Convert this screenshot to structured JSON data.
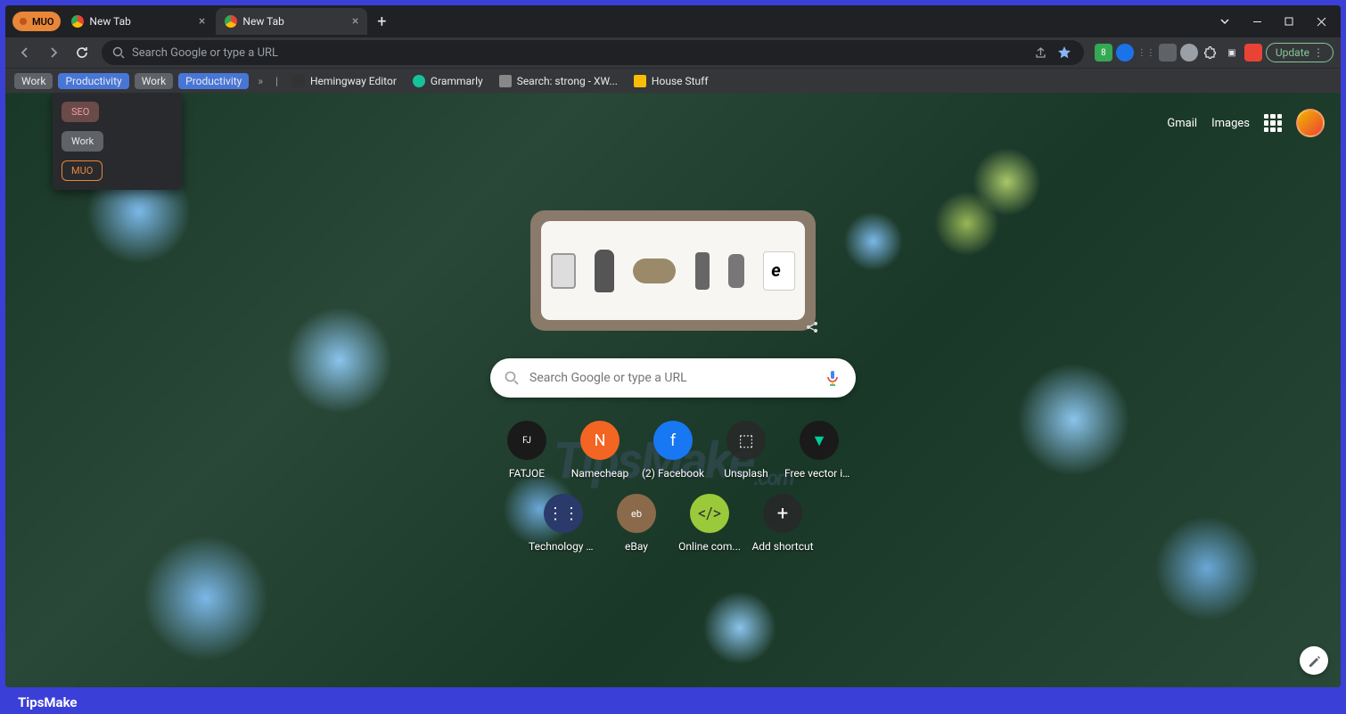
{
  "window": {
    "tabs": [
      {
        "label": "MUO",
        "type": "group"
      },
      {
        "label": "New Tab",
        "type": "tab"
      },
      {
        "label": "New Tab",
        "type": "tab",
        "active": true
      }
    ],
    "update_label": "Update"
  },
  "omnibox": {
    "placeholder": "Search Google or type a URL"
  },
  "bookmarks": {
    "groups": [
      "Work",
      "Productivity",
      "Work",
      "Productivity"
    ],
    "items": [
      {
        "label": "Hemingway Editor"
      },
      {
        "label": "Grammarly"
      },
      {
        "label": "Search: strong - XW..."
      },
      {
        "label": "House Stuff"
      }
    ]
  },
  "group_dropdown": {
    "items": [
      "SEO",
      "Work",
      "MUO"
    ]
  },
  "top_links": {
    "gmail": "Gmail",
    "images": "Images"
  },
  "search": {
    "placeholder": "Search Google or type a URL"
  },
  "shortcuts": {
    "row1": [
      {
        "label": "FATJOE"
      },
      {
        "label": "Namecheap"
      },
      {
        "label": "(2) Facebook"
      },
      {
        "label": "Unsplash"
      },
      {
        "label": "Free vector ic..."
      }
    ],
    "row2": [
      {
        "label": "Technology O..."
      },
      {
        "label": "eBay"
      },
      {
        "label": "Online com..."
      },
      {
        "label": "Add shortcut"
      }
    ]
  },
  "watermark": {
    "main": "TipsMake",
    "suffix": ".com"
  },
  "footer": {
    "brand": "TipsMake"
  }
}
